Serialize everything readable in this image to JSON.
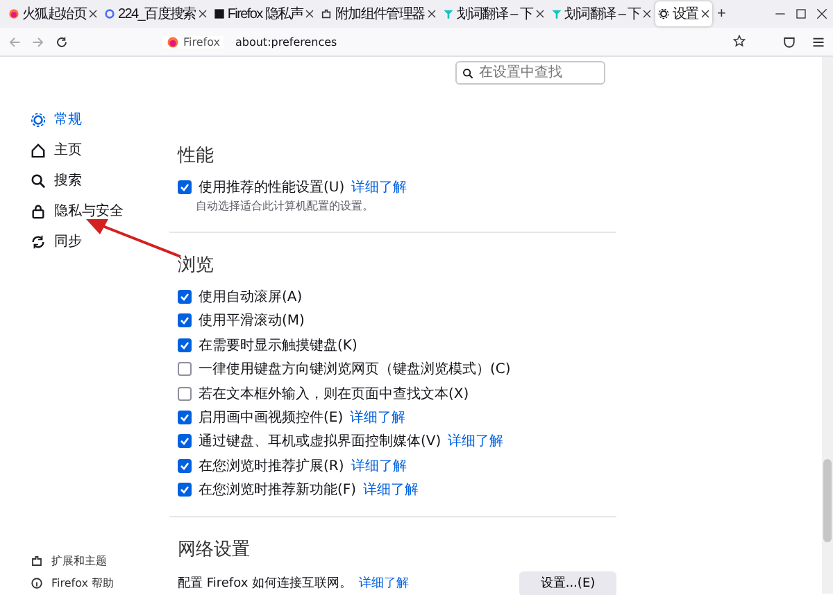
{
  "tabs": [
    {
      "title": "火狐起始页",
      "selected": false
    },
    {
      "title": "224_百度搜索",
      "selected": false
    },
    {
      "title": "Firefox 隐私声",
      "selected": false
    },
    {
      "title": "附加组件管理器",
      "selected": false
    },
    {
      "title": "划词翻译 – 下",
      "selected": false
    },
    {
      "title": "划词翻译 – 下",
      "selected": false
    },
    {
      "title": "设置",
      "selected": true
    }
  ],
  "new_tab": "+",
  "address_bar": {
    "identity": "Firefox",
    "url": "about:preferences"
  },
  "search": {
    "placeholder": "在设置中查找"
  },
  "sidebar": {
    "items": [
      {
        "label": "常规",
        "selected": true
      },
      {
        "label": "主页",
        "selected": false
      },
      {
        "label": "搜索",
        "selected": false
      },
      {
        "label": "隐私与安全",
        "selected": false
      },
      {
        "label": "同步",
        "selected": false
      }
    ],
    "footer_items": [
      {
        "label": "扩展和主题"
      },
      {
        "label": "Firefox 帮助"
      }
    ]
  },
  "sections": [
    {
      "heading": "性能",
      "items": [
        {
          "kind": "checkbox",
          "label": "使用推荐的性能设置(U)",
          "checked": true,
          "link": "详细了解"
        },
        {
          "kind": "note",
          "label": "自动选择适合此计算机配置的设置。"
        }
      ]
    },
    {
      "heading": "浏览",
      "items": [
        {
          "kind": "checkbox",
          "label": "使用自动滚屏(A)",
          "checked": true
        },
        {
          "kind": "checkbox",
          "label": "使用平滑滚动(M)",
          "checked": true
        },
        {
          "kind": "checkbox",
          "label": "在需要时显示触摸键盘(K)",
          "checked": true
        },
        {
          "kind": "checkbox",
          "label": "一律使用键盘方向键浏览网页（键盘浏览模式）(C)",
          "checked": false
        },
        {
          "kind": "checkbox",
          "label": "若在文本框外输入，则在页面中查找文本(X)",
          "checked": false
        },
        {
          "kind": "checkbox",
          "label": "启用画中画视频控件(E)",
          "checked": true,
          "link": "详细了解"
        },
        {
          "kind": "checkbox",
          "label": "通过键盘、耳机或虚拟界面控制媒体(V)",
          "checked": true,
          "link": "详细了解"
        },
        {
          "kind": "checkbox",
          "label": "在您浏览时推荐扩展(R)",
          "checked": true,
          "link": "详细了解"
        },
        {
          "kind": "checkbox",
          "label": "在您浏览时推荐新功能(F)",
          "checked": true,
          "link": "详细了解"
        }
      ]
    },
    {
      "heading": "网络设置",
      "items": [
        {
          "kind": "setting",
          "label": "配置 Firefox 如何连接互联网。",
          "link": "详细了解",
          "button": "设置...(E)"
        }
      ]
    }
  ]
}
